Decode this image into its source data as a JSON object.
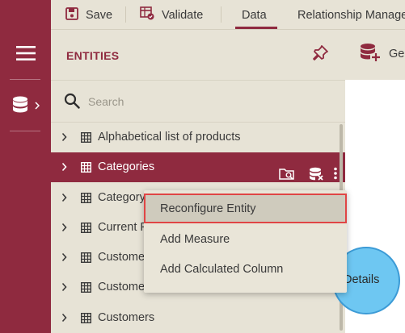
{
  "toolbar": {
    "save_label": "Save",
    "validate_label": "Validate",
    "data_tab_label": "Data",
    "relationship_tab_label": "Relationship Manage"
  },
  "panel": {
    "title": "ENTITIES",
    "generate_label": "Ge"
  },
  "search": {
    "placeholder": "Search"
  },
  "entities": [
    {
      "label": "Alphabetical list of products",
      "selected": false
    },
    {
      "label": "Categories",
      "selected": true
    },
    {
      "label": "Category",
      "selected": false
    },
    {
      "label": "Current P",
      "selected": false
    },
    {
      "label": "Custome",
      "selected": false
    },
    {
      "label": "Customer Demograph",
      "selected": false
    },
    {
      "label": "Customers",
      "selected": false
    }
  ],
  "context_menu": {
    "items": [
      {
        "label": "Reconfigure Entity",
        "highlighted": true
      },
      {
        "label": "Add Measure",
        "highlighted": false
      },
      {
        "label": "Add Calculated Column",
        "highlighted": false
      }
    ]
  },
  "canvas": {
    "bubble_label": "Details"
  },
  "colors": {
    "accent": "#8f2a3f",
    "panel_bg": "#e7e3d6",
    "bubble_fill": "#6ec7f2",
    "highlight_border": "#e04545"
  },
  "icons": {
    "rail_menu": "hamburger-icon",
    "rail_db": "database-icon",
    "save": "floppy-disk-icon",
    "validate": "validate-table-icon",
    "pin": "pin-icon",
    "generate": "database-add-icon",
    "search": "search-icon",
    "row_expand": "chevron-right-icon",
    "row_table": "table-icon",
    "row_view": "folder-search-icon",
    "row_remove": "database-remove-icon",
    "row_more": "more-vertical-icon"
  }
}
